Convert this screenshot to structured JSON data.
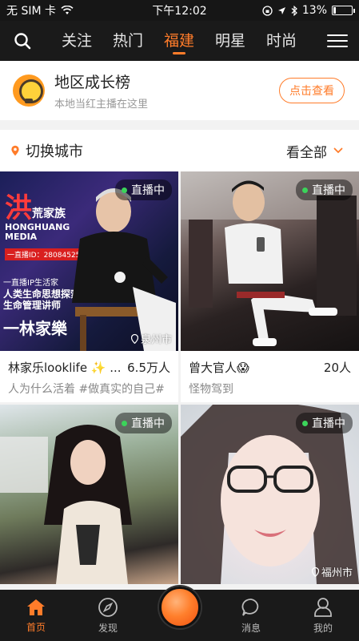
{
  "status_bar": {
    "carrier": "无 SIM 卡",
    "time": "下午12:02",
    "battery": "13%",
    "battery_level": 0.13
  },
  "top_nav": {
    "tabs": [
      {
        "label": "关注"
      },
      {
        "label": "热门"
      },
      {
        "label": "福建",
        "active": true
      },
      {
        "label": "明星"
      },
      {
        "label": "时尚"
      }
    ],
    "icons": [
      "search-icon",
      "menu-icon"
    ]
  },
  "banner": {
    "title": "地区成长榜",
    "subtitle": "本地当红主播在这里",
    "button_label": "点击查看"
  },
  "city_row": {
    "label": "切换城市",
    "view_all": "看全部"
  },
  "cards": [
    {
      "badge": "直播中",
      "location": "泉州市",
      "name": "林家乐looklife ✨ ...",
      "count": "6.5万人",
      "desc": "人为什么活着 #做真实的自己#",
      "poster": {
        "title": "洪",
        "title2": "荒家族",
        "brand1": "HONGHUANG",
        "brand2": "MEDIA",
        "id_tag": "一直播ID：280845252",
        "slogan": "一直播IP生活家",
        "role1": "人类生命思想探索者",
        "role2": "生命管理讲师",
        "person": "一林家樂"
      }
    },
    {
      "badge": "直播中",
      "location": "",
      "name": "曾大官人😱",
      "count": "20人",
      "desc": "怪物驾到"
    },
    {
      "badge": "直播中",
      "location": "",
      "name": "",
      "count": "",
      "desc": ""
    },
    {
      "badge": "直播中",
      "location": "福州市",
      "name": "",
      "count": "",
      "desc": ""
    }
  ],
  "tab_bar": {
    "items": [
      {
        "label": "首页",
        "icon": "home-icon",
        "active": true
      },
      {
        "label": "发现",
        "icon": "compass-icon"
      },
      {
        "label": "",
        "icon": "live-record-icon"
      },
      {
        "label": "消息",
        "icon": "message-icon"
      },
      {
        "label": "我的",
        "icon": "profile-icon"
      }
    ]
  },
  "colors": {
    "accent": "#ff7c2a",
    "nav_bg": "#1a1a1a",
    "live_dot": "#3bd45a"
  }
}
